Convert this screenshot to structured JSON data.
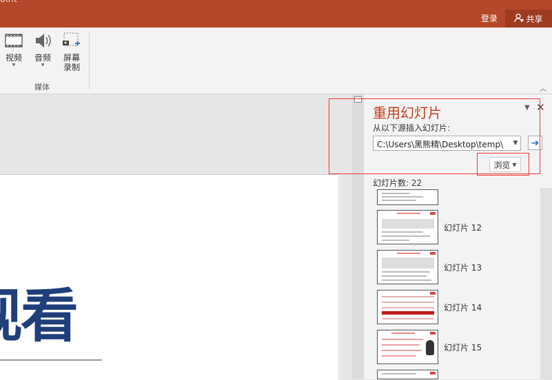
{
  "titlebar": {
    "partial_title": "oint",
    "login": "登录",
    "share": "共享"
  },
  "ribbon": {
    "video": "视频",
    "audio": "音频",
    "screen_record_line1": "屏幕",
    "screen_record_line2": "录制",
    "group_label": "媒体"
  },
  "slide": {
    "big_text": "观看"
  },
  "pane": {
    "title": "重用幻灯片",
    "source_label": "从以下源插入幻灯片:",
    "path_value": "C:\\Users\\黑熊精\\Desktop\\temp\\",
    "browse": "浏览",
    "count": "幻灯片数: 22",
    "thumbnails": [
      {
        "label": ""
      },
      {
        "label": "幻灯片 12"
      },
      {
        "label": "幻灯片 13"
      },
      {
        "label": "幻灯片 14"
      },
      {
        "label": "幻灯片 15"
      },
      {
        "label": ""
      }
    ]
  }
}
